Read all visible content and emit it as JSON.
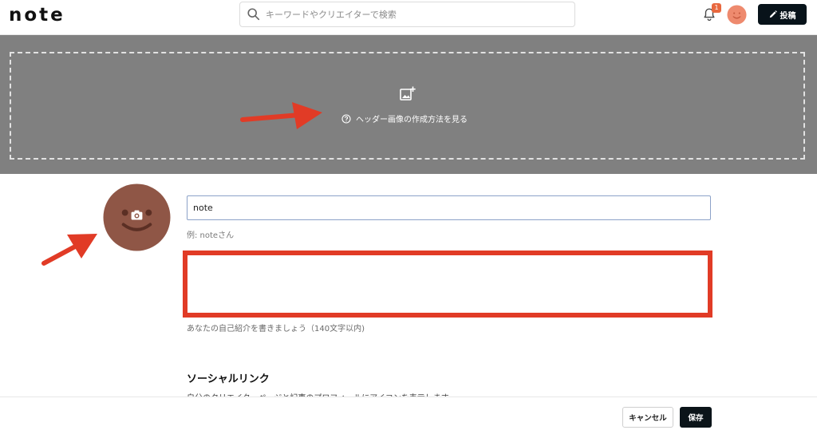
{
  "app": {
    "logo": "note"
  },
  "search": {
    "placeholder": "キーワードやクリエイターで検索",
    "icon": "search-icon"
  },
  "notifications": {
    "count": "1",
    "icon": "bell-icon"
  },
  "header": {
    "post_label": "投稿",
    "post_icon": "pencil-icon"
  },
  "header_image": {
    "help_text": "ヘッダー画像の作成方法を見る",
    "add_icon": "add-image-icon",
    "help_icon": "question-circle-icon",
    "background": "#808080"
  },
  "profile": {
    "avatar_icon": "camera-icon",
    "name_value": "note",
    "name_hint": "例: noteさん",
    "bio_value": "",
    "bio_hint": "あなたの自己紹介を書きましょう（140文字以内)"
  },
  "social": {
    "title": "ソーシャルリンク",
    "description": "自分のクリエイターページと記事のプロフィールにアイコンを表示します"
  },
  "footer": {
    "cancel_label": "キャンセル",
    "save_label": "保存"
  },
  "colors": {
    "accent": "#e8683f",
    "annotation_red": "#e13b26",
    "avatar_brown": "#8f5646",
    "dark_button": "#0b1419"
  }
}
